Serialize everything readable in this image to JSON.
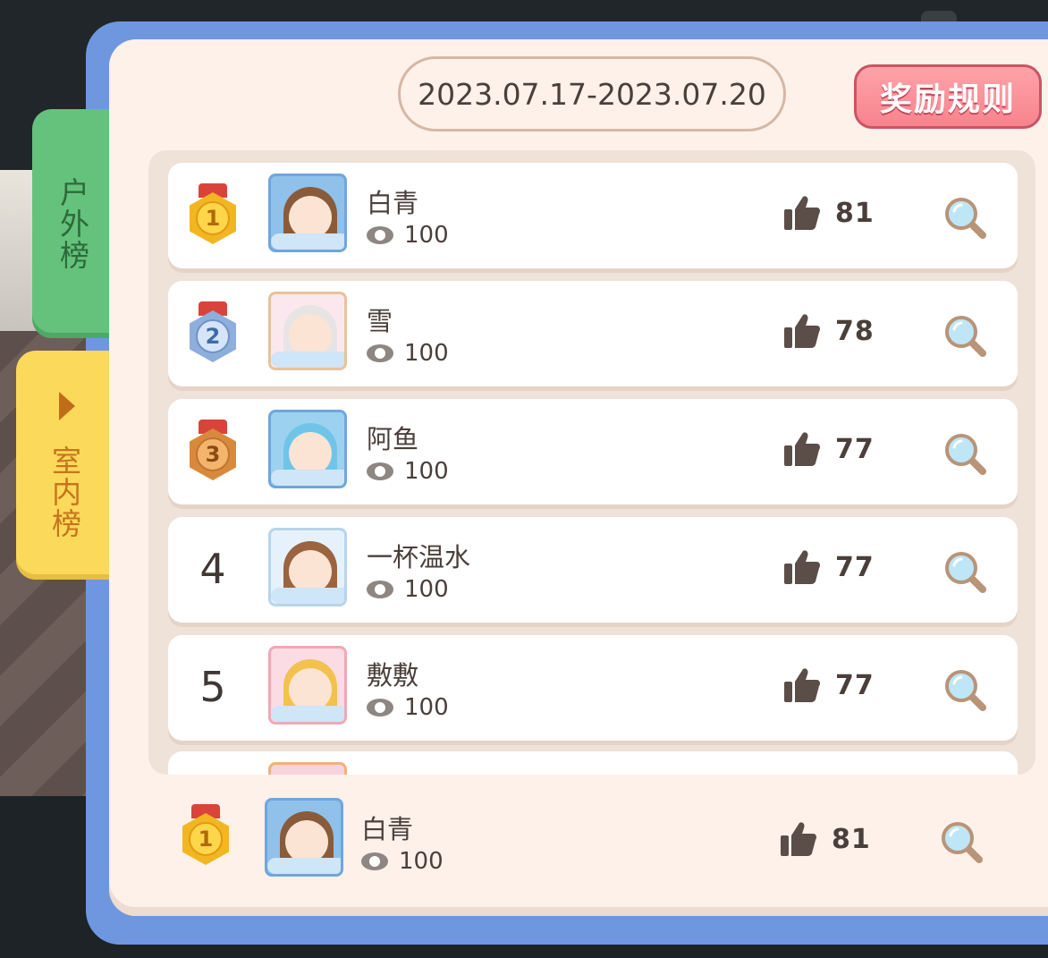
{
  "tabs": [
    {
      "label": "户外榜",
      "active": false
    },
    {
      "label": "室内榜",
      "active": true
    }
  ],
  "date_range": "2023.07.17-2023.07.20",
  "rules_button": "奖励规则",
  "colors": {
    "frame": "#6f97e0",
    "outdoor_tab": "#64c27c",
    "indoor_tab": "#fbd95a",
    "rules_button": "#f7838d"
  },
  "leaderboard": [
    {
      "rank": "1",
      "medal": "gold",
      "name": "白青",
      "views": "100",
      "likes": "81",
      "avatar_icon": "girl-brown-hair-avatar"
    },
    {
      "rank": "2",
      "medal": "silver",
      "name": "雪",
      "views": "100",
      "likes": "78",
      "avatar_icon": "girl-white-hair-avatar"
    },
    {
      "rank": "3",
      "medal": "bronze",
      "name": "阿鱼",
      "views": "100",
      "likes": "77",
      "avatar_icon": "girl-blue-hair-avatar"
    },
    {
      "rank": "4",
      "medal": "",
      "name": "一杯温水",
      "views": "100",
      "likes": "77",
      "avatar_icon": "girl-rainbow-avatar"
    },
    {
      "rank": "5",
      "medal": "",
      "name": "敷敷",
      "views": "100",
      "likes": "77",
      "avatar_icon": "girl-blonde-hair-avatar"
    }
  ],
  "self_entry": {
    "rank": "1",
    "medal": "gold",
    "name": "白青",
    "views": "100",
    "likes": "81"
  }
}
